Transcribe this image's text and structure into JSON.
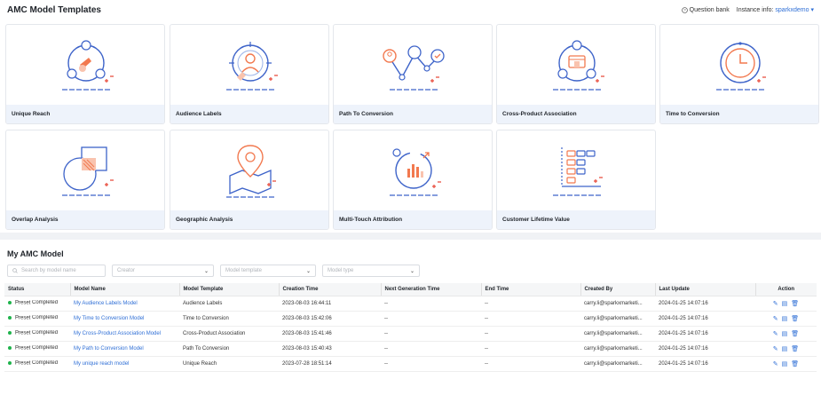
{
  "header": {
    "title": "AMC Model Templates",
    "question_bank": "Question bank",
    "instance_label": "Instance info:",
    "instance_value": "sparkxdemo"
  },
  "templates": [
    {
      "label": "Unique Reach",
      "icon": "unique-reach-icon"
    },
    {
      "label": "Audience Labels",
      "icon": "audience-labels-icon"
    },
    {
      "label": "Path To Conversion",
      "icon": "path-to-conversion-icon"
    },
    {
      "label": "Cross-Product Association",
      "icon": "cross-product-icon"
    },
    {
      "label": "Time to Conversion",
      "icon": "clock-icon"
    },
    {
      "label": "Overlap Analysis",
      "icon": "overlap-icon"
    },
    {
      "label": "Geographic Analysis",
      "icon": "map-pin-icon"
    },
    {
      "label": "Multi-Touch Attribution",
      "icon": "attribution-icon"
    },
    {
      "label": "Customer Lifetime Value",
      "icon": "lifetime-value-icon"
    }
  ],
  "models": {
    "title": "My AMC Model",
    "filters": {
      "search_placeholder": "Search by model name",
      "creator": "Creator",
      "template": "Model template",
      "type": "Model type"
    },
    "columns": [
      "Status",
      "Model Name",
      "Model Template",
      "Creation Time",
      "Next Generation Time",
      "End Time",
      "Created By",
      "Last Update",
      "Action"
    ],
    "rows": [
      {
        "type": "Preset",
        "status": "Completed",
        "name": "My Audience Labels Model",
        "template": "Audience Labels",
        "created": "2023-08-03 16:44:11",
        "next": "--",
        "end": "--",
        "by": "carry.li@sparkxmarketi...",
        "updated": "2024-01-25 14:07:16"
      },
      {
        "type": "Preset",
        "status": "Completed",
        "name": "My Time to Conversion Model",
        "template": "Time to Conversion",
        "created": "2023-08-03 15:42:06",
        "next": "--",
        "end": "--",
        "by": "carry.li@sparkxmarketi...",
        "updated": "2024-01-25 14:07:16"
      },
      {
        "type": "Preset",
        "status": "Completed",
        "name": "My Cross-Product Association Model",
        "template": "Cross-Product Association",
        "created": "2023-08-03 15:41:46",
        "next": "--",
        "end": "--",
        "by": "carry.li@sparkxmarketi...",
        "updated": "2024-01-25 14:07:16"
      },
      {
        "type": "Preset",
        "status": "Completed",
        "name": "My Path to Conversion Model",
        "template": "Path To Conversion",
        "created": "2023-08-03 15:40:43",
        "next": "--",
        "end": "--",
        "by": "carry.li@sparkxmarketi...",
        "updated": "2024-01-25 14:07:16"
      },
      {
        "type": "Preset",
        "status": "Completed",
        "name": "My unique reach model",
        "template": "Unique Reach",
        "created": "2023-07-28 18:51:14",
        "next": "--",
        "end": "--",
        "by": "carry.li@sparkxmarketi...",
        "updated": "2024-01-25 14:07:16"
      }
    ]
  }
}
